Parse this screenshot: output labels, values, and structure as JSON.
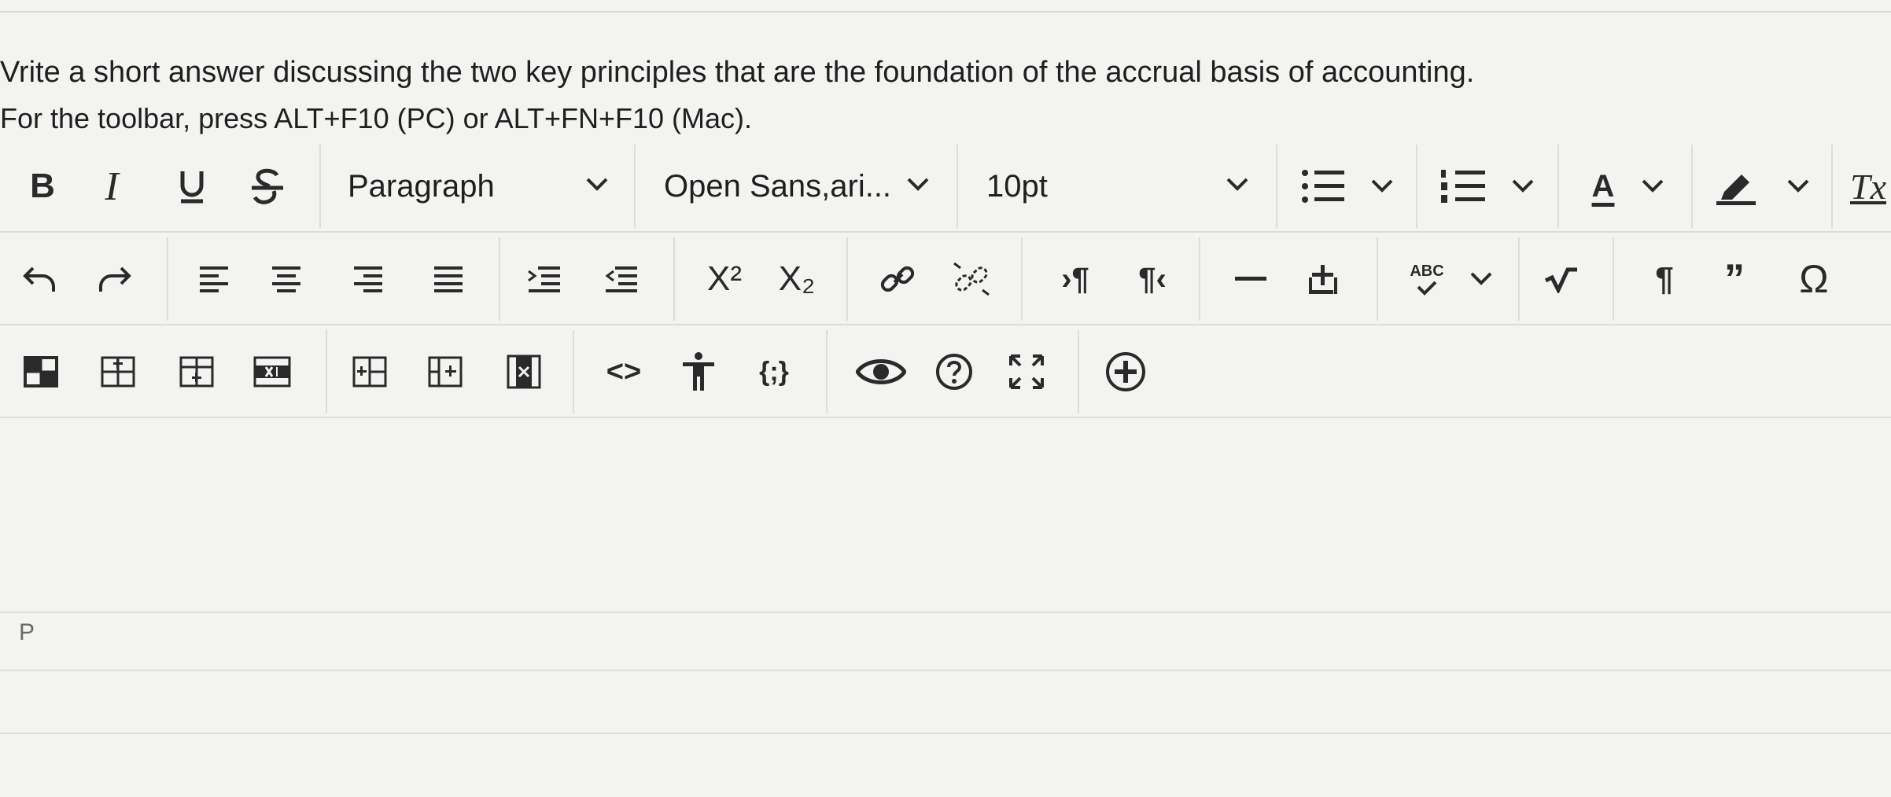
{
  "question": {
    "text": "Vrite a short answer discussing the two key principles that are the foundation of the accrual basis of accounting.",
    "hint": "For the toolbar, press ALT+F10 (PC) or ALT+FN+F10 (Mac)."
  },
  "toolbar": {
    "bold_label": "B",
    "italic_label": "I",
    "block_format_value": "Paragraph",
    "font_family_value": "Open Sans,ari...",
    "font_size_value": "10pt",
    "text_color_label": "A",
    "clear_format_label": "Tx",
    "superscript_label": "X²",
    "subscript_label": "X₂",
    "ltr_label": "›¶",
    "rtl_label": "¶‹",
    "spellcheck_label": "ABC",
    "omega_label": "Ω",
    "code_label": "<>",
    "template_label": "{;}"
  },
  "editor": {
    "status_path": "P"
  },
  "colors": {
    "background": "#f3f3f1",
    "icon": "#2a2a2a",
    "divider": "#dcdcda"
  }
}
